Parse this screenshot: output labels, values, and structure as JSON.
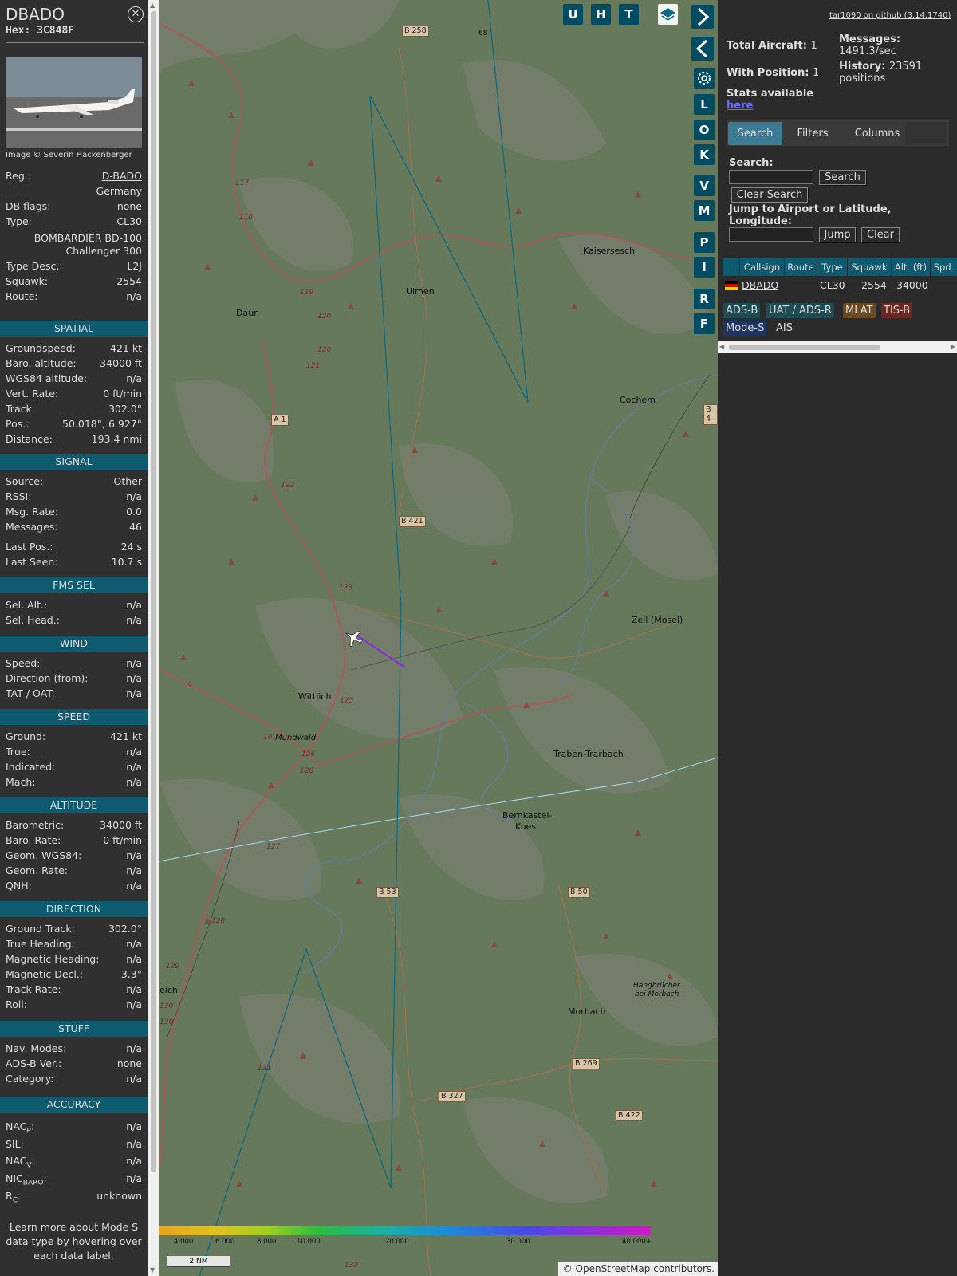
{
  "aircraft": {
    "title": "DBADO",
    "hex": "Hex: 3C848F",
    "close_icon": "close-icon",
    "image_credit": "Image © Severin Hackenberger"
  },
  "basic": {
    "reg_label": "Reg.:",
    "reg_value": "D-BADO",
    "country": "Germany",
    "dbflags_label": "DB flags:",
    "dbflags_value": "none",
    "type_label": "Type:",
    "type_value": "CL30",
    "type_name_1": "BOMBARDIER BD-100",
    "type_name_2": "Challenger 300",
    "typedesc_label": "Type Desc.:",
    "typedesc_value": "L2J",
    "squawk_label": "Squawk:",
    "squawk_value": "2554",
    "route_label": "Route:",
    "route_value": "n/a"
  },
  "spatial": {
    "header": "SPATIAL",
    "rows": [
      {
        "k": "Groundspeed:",
        "v": "421 kt"
      },
      {
        "k": "Baro. altitude:",
        "v": "34000 ft"
      },
      {
        "k": "WGS84 altitude:",
        "v": "n/a"
      },
      {
        "k": "Vert. Rate:",
        "v": "0 ft/min"
      },
      {
        "k": "Track:",
        "v": "302.0°"
      },
      {
        "k": "Pos.:",
        "v": "50.018°, 6.927°"
      },
      {
        "k": "Distance:",
        "v": "193.4 nmi"
      }
    ]
  },
  "signal": {
    "header": "SIGNAL",
    "rows": [
      {
        "k": "Source:",
        "v": "Other"
      },
      {
        "k": "RSSI:",
        "v": "n/a"
      },
      {
        "k": "Msg. Rate:",
        "v": "0.0"
      },
      {
        "k": "Messages:",
        "v": "46"
      },
      {
        "k": "Last Pos.:",
        "v": "24 s"
      },
      {
        "k": "Last Seen:",
        "v": "10.7 s"
      }
    ]
  },
  "fms": {
    "header": "FMS SEL",
    "rows": [
      {
        "k": "Sel. Alt.:",
        "v": "n/a"
      },
      {
        "k": "Sel. Head.:",
        "v": "n/a"
      }
    ]
  },
  "wind": {
    "header": "WIND",
    "rows": [
      {
        "k": "Speed:",
        "v": "n/a"
      },
      {
        "k": "Direction (from):",
        "v": "n/a"
      },
      {
        "k": "TAT / OAT:",
        "v": "n/a"
      }
    ]
  },
  "speed": {
    "header": "SPEED",
    "rows": [
      {
        "k": "Ground:",
        "v": "421 kt"
      },
      {
        "k": "True:",
        "v": "n/a"
      },
      {
        "k": "Indicated:",
        "v": "n/a"
      },
      {
        "k": "Mach:",
        "v": "n/a"
      }
    ]
  },
  "altitude": {
    "header": "ALTITUDE",
    "rows": [
      {
        "k": "Barometric:",
        "v": "34000 ft"
      },
      {
        "k": "Baro. Rate:",
        "v": "0 ft/min"
      },
      {
        "k": "Geom. WGS84:",
        "v": "n/a"
      },
      {
        "k": "Geom. Rate:",
        "v": "n/a"
      },
      {
        "k": "QNH:",
        "v": "n/a"
      }
    ]
  },
  "direction": {
    "header": "DIRECTION",
    "rows": [
      {
        "k": "Ground Track:",
        "v": "302.0°"
      },
      {
        "k": "True Heading:",
        "v": "n/a"
      },
      {
        "k": "Magnetic Heading:",
        "v": "n/a"
      },
      {
        "k": "Magnetic Decl.:",
        "v": "3.3°"
      },
      {
        "k": "Track Rate:",
        "v": "n/a"
      },
      {
        "k": "Roll:",
        "v": "n/a"
      }
    ]
  },
  "stuff": {
    "header": "STUFF",
    "rows": [
      {
        "k": "Nav. Modes:",
        "v": "n/a"
      },
      {
        "k": "ADS-B Ver.:",
        "v": "none"
      },
      {
        "k": "Category:",
        "v": "n/a"
      }
    ]
  },
  "accuracy": {
    "header": "ACCURACY",
    "nacp": "NAC",
    "nacp_sub": "P",
    "nacp_v": "n/a",
    "sil": "SIL:",
    "sil_v": "n/a",
    "nacv": "NAC",
    "nacv_sub": "V",
    "nacv_v": "n/a",
    "nicbaro": "NIC",
    "nicbaro_sub": "BARO",
    "nicbaro_v": "n/a",
    "rc": "R",
    "rc_sub": "C",
    "rc_v": "unknown"
  },
  "learn_more": "Learn more about Mode S data type by hovering over each data label.",
  "map": {
    "top_buttons": [
      "U",
      "H",
      "T"
    ],
    "side_buttons": [
      "L",
      "O",
      "K",
      "V",
      "M",
      "P",
      "I",
      "R",
      "F"
    ],
    "towns": [
      "Kaisersesch",
      "Ulmen",
      "Daun",
      "Cochem",
      "Zell (Mosel)",
      "Wittlich",
      "Traben-Trarbach",
      "Bernkastel-",
      "Kues",
      "Morbach",
      "Mundwald",
      "Hangbrücher",
      "bei Morbach",
      "eich"
    ],
    "roads": [
      "B 258",
      "A 1",
      "B 421",
      "B 53",
      "B 50",
      "B 269",
      "B 327",
      "B 422",
      "B 4",
      "68"
    ],
    "legend_labels": [
      "4 000",
      "6 000",
      "8 000",
      "10 000",
      "20 000",
      "30 000",
      "40 000+"
    ],
    "scale": "2 NM",
    "attribution": "© OpenStreetMap contributors."
  },
  "right": {
    "github": "tar1090 on github (3.14.1740)",
    "total_label": "Total Aircraft:",
    "total_value": "1",
    "withpos_label": "With Position:",
    "withpos_value": "1",
    "stats_label": "Stats available",
    "stats_link": "here",
    "messages_label": "Messages:",
    "messages_value": "1491.3/sec",
    "history_label": "History:",
    "history_value": "23591",
    "history_unit": "positions",
    "tabs": [
      "Search",
      "Filters",
      "Columns"
    ],
    "search_label": "Search:",
    "search_button": "Search",
    "clear_search_button": "Clear Search",
    "jump_label": "Jump to Airport or Latitude, Longitude:",
    "jump_button": "Jump",
    "clear_button": "Clear",
    "columns": [
      "Callsign",
      "Route",
      "Type",
      "Squawk",
      "Alt. (ft)",
      "Spd."
    ],
    "row": {
      "callsign": "DBADO",
      "route": "",
      "type": "CL30",
      "squawk": "2554",
      "alt": "34000"
    },
    "badges": [
      "ADS-B",
      "UAT / ADS-R",
      "MLAT",
      "TIS-B",
      "Mode-S",
      "AIS"
    ],
    "badge_colors": [
      "#1d4a55",
      "#1d4a55",
      "#6b4a1f",
      "#6a2a22",
      "#1d3560",
      "#2b2b2b"
    ]
  }
}
